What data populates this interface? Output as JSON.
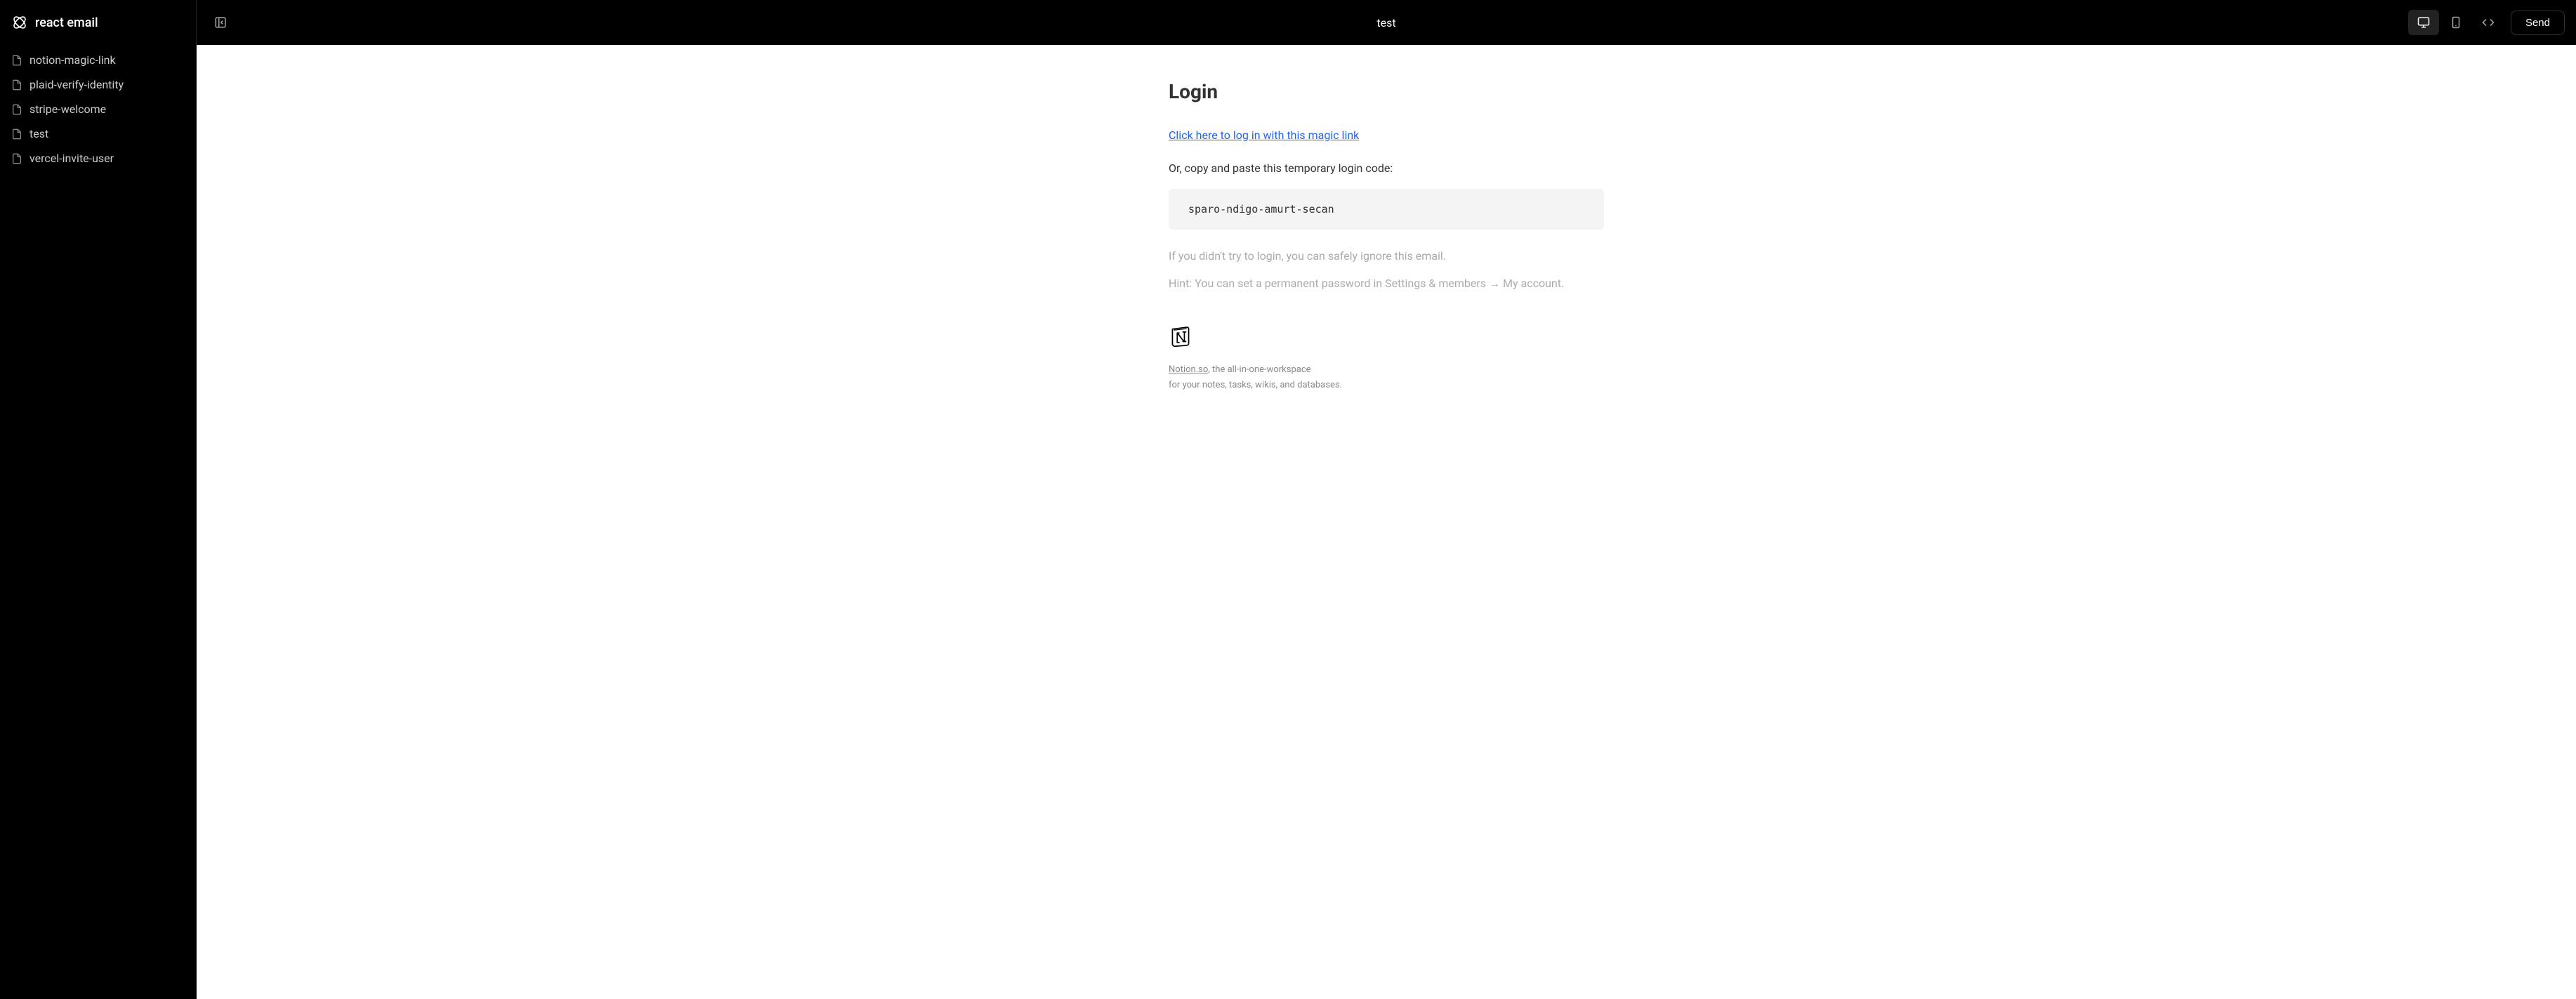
{
  "sidebar": {
    "brand": "react email",
    "items": [
      {
        "label": "notion-magic-link"
      },
      {
        "label": "plaid-verify-identity"
      },
      {
        "label": "stripe-welcome"
      },
      {
        "label": "test"
      },
      {
        "label": "vercel-invite-user"
      }
    ]
  },
  "topbar": {
    "title": "test",
    "send_label": "Send"
  },
  "email": {
    "heading": "Login",
    "magic_link_text": "Click here to log in with this magic link",
    "or_text": "Or, copy and paste this temporary login code:",
    "code": "sparo-ndigo-amurt-secan",
    "ignore_text": "If you didn't try to login, you can safely ignore this email.",
    "hint_text": "Hint: You can set a permanent password in Settings & members → My account.",
    "footer_link": "Notion.so",
    "footer_suffix": ", the all-in-one-workspace",
    "footer_line2": "for your notes, tasks, wikis, and databases."
  }
}
